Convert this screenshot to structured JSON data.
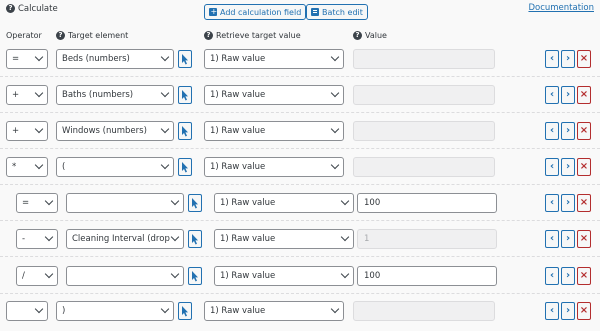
{
  "header": {
    "calculate_label": "Calculate",
    "add_calc_label": "Add calculation field",
    "batch_edit_label": "Batch edit",
    "documentation_label": "Documentation"
  },
  "columns": {
    "operator": "Operator",
    "target": "Target element",
    "retrieve": "Retrieve target value",
    "value": "Value"
  },
  "rows": [
    {
      "operator": "=",
      "target": "Beds (numbers)",
      "retrieve": "1) Raw value",
      "value": "",
      "value_disabled": true
    },
    {
      "operator": "+",
      "target": "Baths (numbers)",
      "retrieve": "1) Raw value",
      "value": "",
      "value_disabled": true
    },
    {
      "operator": "+",
      "target": "Windows (numbers)",
      "retrieve": "1) Raw value",
      "value": "",
      "value_disabled": true
    },
    {
      "operator": "*",
      "target": "(",
      "retrieve": "1) Raw value",
      "value": "",
      "value_disabled": true
    },
    {
      "operator": "=",
      "target": "",
      "retrieve": "1) Raw value",
      "value": "100",
      "value_disabled": false
    },
    {
      "operator": "-",
      "target": "Cleaning Interval (drop",
      "retrieve": "1) Raw value",
      "value": "1",
      "value_disabled": true
    },
    {
      "operator": "/",
      "target": "",
      "retrieve": "1) Raw value",
      "value": "100",
      "value_disabled": false
    },
    {
      "operator": "",
      "target": ")",
      "retrieve": "1) Raw value",
      "value": "",
      "value_disabled": true
    }
  ],
  "icons": {
    "help": "question-circle-icon",
    "add": "plus-square-icon",
    "batch": "list-icon",
    "picker": "cursor-arrow-icon",
    "move_left": "chevron-left-icon",
    "move_right": "chevron-right-icon",
    "delete": "x-delete-icon",
    "dropdown": "chevron-down-icon"
  },
  "colors": {
    "accent": "#2271b1",
    "delete": "#b32d2e",
    "background": "#f9f9f9"
  }
}
